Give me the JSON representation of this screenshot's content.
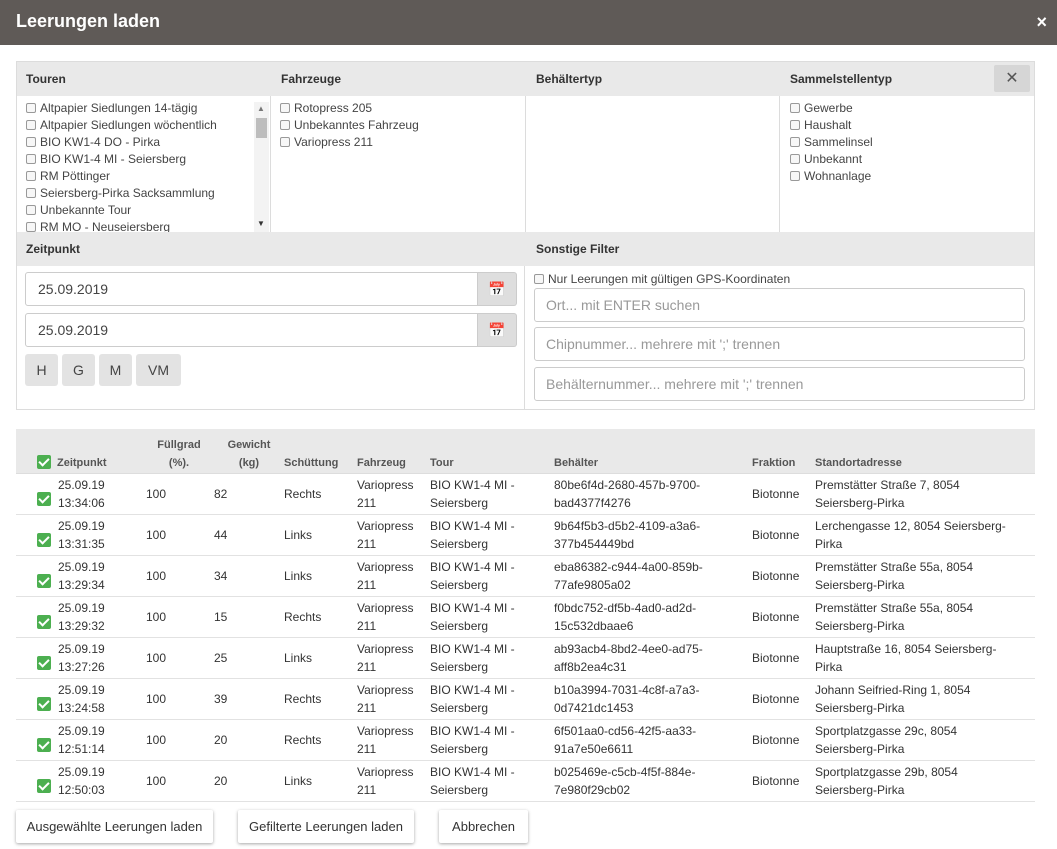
{
  "dialog": {
    "title": "Leerungen laden",
    "close_glyph": "×"
  },
  "filters": {
    "headers": {
      "touren": "Touren",
      "fahrzeuge": "Fahrzeuge",
      "behaeltertyp": "Behältertyp",
      "sammelstellentyp": "Sammelstellentyp"
    },
    "close_glyph": "✕",
    "touren": [
      "Altpapier Siedlungen 14-tägig",
      "Altpapier Siedlungen wöchentlich",
      "BIO KW1-4 DO - Pirka",
      "BIO KW1-4 MI - Seiersberg",
      "RM Pöttinger",
      "Seiersberg-Pirka Sacksammlung",
      "Unbekannte Tour",
      "RM MO - Neuseiersberg"
    ],
    "fahrzeuge": [
      "Rotopress 205",
      "Unbekanntes Fahrzeug",
      "Variopress 211"
    ],
    "behaeltertyp": [],
    "sammelstellentyp": [
      "Gewerbe",
      "Haushalt",
      "Sammelinsel",
      "Unbekannt",
      "Wohnanlage"
    ]
  },
  "zeitpunkt": {
    "header": "Zeitpunkt",
    "from": "25.09.2019",
    "to": "25.09.2019",
    "quick_buttons": [
      "H",
      "G",
      "M",
      "VM"
    ]
  },
  "sonstige": {
    "header": "Sonstige Filter",
    "gps_label": "Nur Leerungen mit gültigen GPS-Koordinaten",
    "ort_placeholder": "Ort... mit ENTER suchen",
    "chip_placeholder": "Chipnummer... mehrere mit ';' trennen",
    "behaelter_placeholder": "Behälternummer... mehrere mit ';' trennen"
  },
  "table": {
    "headers": {
      "zeitpunkt": "Zeitpunkt",
      "fuellgrad_1": "Füllgrad",
      "fuellgrad_2": "(%).",
      "gewicht_1": "Gewicht",
      "gewicht_2": "(kg)",
      "schuettung": "Schüttung",
      "fahrzeug": "Fahrzeug",
      "tour": "Tour",
      "behaelter": "Behälter",
      "fraktion": "Fraktion",
      "standort": "Standortadresse"
    },
    "rows": [
      {
        "date": "25.09.19",
        "time": "13:34:06",
        "fuellgrad": "100",
        "gewicht": "82",
        "schuettung": "Rechts",
        "fahrzeug_1": "Variopress",
        "fahrzeug_2": "211",
        "tour_1": "BIO KW1-4 MI -",
        "tour_2": "Seiersberg",
        "behaelter_1": "80be6f4d-2680-457b-9700-",
        "behaelter_2": "bad4377f4276",
        "fraktion": "Biotonne",
        "standort_1": "Premstätter Straße 7, 8054",
        "standort_2": "Seiersberg-Pirka"
      },
      {
        "date": "25.09.19",
        "time": "13:31:35",
        "fuellgrad": "100",
        "gewicht": "44",
        "schuettung": "Links",
        "fahrzeug_1": "Variopress",
        "fahrzeug_2": "211",
        "tour_1": "BIO KW1-4 MI -",
        "tour_2": "Seiersberg",
        "behaelter_1": "9b64f5b3-d5b2-4109-a3a6-",
        "behaelter_2": "377b454449bd",
        "fraktion": "Biotonne",
        "standort_1": "Lerchengasse 12, 8054 Seiersberg-",
        "standort_2": "Pirka"
      },
      {
        "date": "25.09.19",
        "time": "13:29:34",
        "fuellgrad": "100",
        "gewicht": "34",
        "schuettung": "Links",
        "fahrzeug_1": "Variopress",
        "fahrzeug_2": "211",
        "tour_1": "BIO KW1-4 MI -",
        "tour_2": "Seiersberg",
        "behaelter_1": "eba86382-c944-4a00-859b-",
        "behaelter_2": "77afe9805a02",
        "fraktion": "Biotonne",
        "standort_1": "Premstätter Straße 55a, 8054",
        "standort_2": "Seiersberg-Pirka"
      },
      {
        "date": "25.09.19",
        "time": "13:29:32",
        "fuellgrad": "100",
        "gewicht": "15",
        "schuettung": "Rechts",
        "fahrzeug_1": "Variopress",
        "fahrzeug_2": "211",
        "tour_1": "BIO KW1-4 MI -",
        "tour_2": "Seiersberg",
        "behaelter_1": "f0bdc752-df5b-4ad0-ad2d-",
        "behaelter_2": "15c532dbaae6",
        "fraktion": "Biotonne",
        "standort_1": "Premstätter Straße 55a, 8054",
        "standort_2": "Seiersberg-Pirka"
      },
      {
        "date": "25.09.19",
        "time": "13:27:26",
        "fuellgrad": "100",
        "gewicht": "25",
        "schuettung": "Links",
        "fahrzeug_1": "Variopress",
        "fahrzeug_2": "211",
        "tour_1": "BIO KW1-4 MI -",
        "tour_2": "Seiersberg",
        "behaelter_1": "ab93acb4-8bd2-4ee0-ad75-",
        "behaelter_2": "aff8b2ea4c31",
        "fraktion": "Biotonne",
        "standort_1": "Hauptstraße 16, 8054 Seiersberg-",
        "standort_2": "Pirka"
      },
      {
        "date": "25.09.19",
        "time": "13:24:58",
        "fuellgrad": "100",
        "gewicht": "39",
        "schuettung": "Rechts",
        "fahrzeug_1": "Variopress",
        "fahrzeug_2": "211",
        "tour_1": "BIO KW1-4 MI -",
        "tour_2": "Seiersberg",
        "behaelter_1": "b10a3994-7031-4c8f-a7a3-",
        "behaelter_2": "0d7421dc1453",
        "fraktion": "Biotonne",
        "standort_1": "Johann Seifried-Ring 1, 8054",
        "standort_2": "Seiersberg-Pirka"
      },
      {
        "date": "25.09.19",
        "time": "12:51:14",
        "fuellgrad": "100",
        "gewicht": "20",
        "schuettung": "Rechts",
        "fahrzeug_1": "Variopress",
        "fahrzeug_2": "211",
        "tour_1": "BIO KW1-4 MI -",
        "tour_2": "Seiersberg",
        "behaelter_1": "6f501aa0-cd56-42f5-aa33-",
        "behaelter_2": "91a7e50e6611",
        "fraktion": "Biotonne",
        "standort_1": "Sportplatzgasse 29c, 8054",
        "standort_2": "Seiersberg-Pirka"
      },
      {
        "date": "25.09.19",
        "time": "12:50:03",
        "fuellgrad": "100",
        "gewicht": "20",
        "schuettung": "Links",
        "fahrzeug_1": "Variopress",
        "fahrzeug_2": "211",
        "tour_1": "BIO KW1-4 MI -",
        "tour_2": "Seiersberg",
        "behaelter_1": "b025469e-c5cb-4f5f-884e-",
        "behaelter_2": "7e980f29cb02",
        "fraktion": "Biotonne",
        "standort_1": "Sportplatzgasse 29b, 8054",
        "standort_2": "Seiersberg-Pirka"
      }
    ]
  },
  "footer": {
    "load_selected": "Ausgewählte Leerungen laden",
    "load_filtered": "Gefilterte Leerungen laden",
    "cancel": "Abbrechen"
  },
  "colors": {
    "titlebar": "#5f5a57",
    "check": "#4caf50",
    "header_bg": "#e9e9e9"
  },
  "icons": {
    "calendar": "calendar-icon",
    "close": "close-icon",
    "check": "check-icon"
  }
}
